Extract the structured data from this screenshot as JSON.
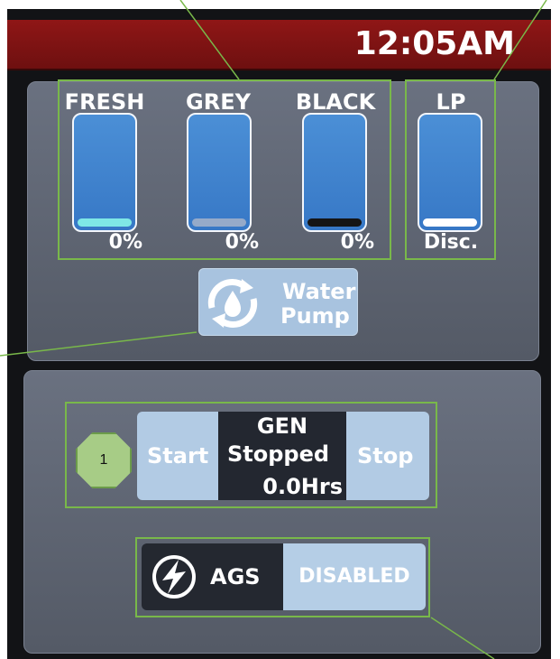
{
  "header": {
    "time": "12:05AM"
  },
  "tanks": [
    {
      "label": "FRESH",
      "level": "0%",
      "fill_color": "#7fe8e6"
    },
    {
      "label": "GREY",
      "level": "0%",
      "fill_color": "#95aac9"
    },
    {
      "label": "BLACK",
      "level": "0%",
      "fill_color": "#151515"
    }
  ],
  "lp": {
    "label": "LP",
    "status": "Disc.",
    "fill_color": "#ffffff"
  },
  "water_pump": {
    "line1": "Water",
    "line2": "Pump",
    "icon": "water-pump-icon"
  },
  "generator": {
    "start_label": "Start",
    "stop_label": "Stop",
    "title": "GEN",
    "state": "Stopped",
    "hours": "0.0Hrs"
  },
  "callout": {
    "number": "1"
  },
  "ags": {
    "label": "AGS",
    "status": "DISABLED",
    "icon": "lightning-circle-icon"
  },
  "colors": {
    "header_bg": "#7e1414",
    "panel_bg": "#5f6572",
    "tank_blue": "#4286d0",
    "highlight_green": "#79b84a",
    "button_light": "#b2cbe4",
    "button_dark": "#232730"
  }
}
